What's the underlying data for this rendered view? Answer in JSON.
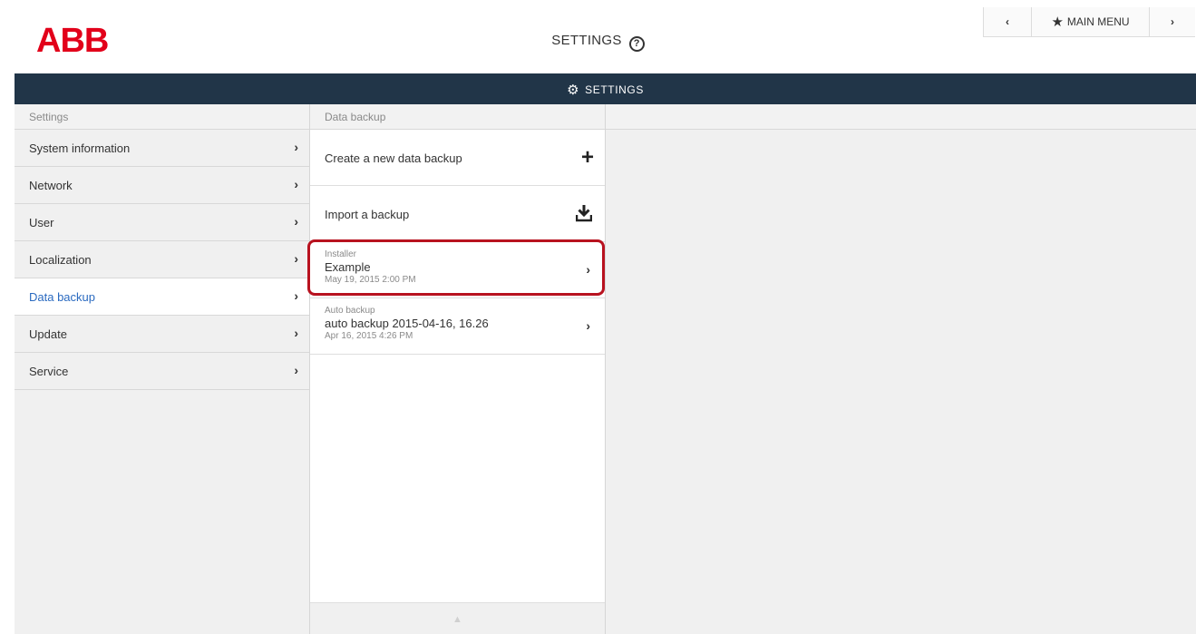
{
  "brand": {
    "logo_text": "ABB",
    "color": "#e2001a"
  },
  "header": {
    "title": "SETTINGS",
    "help_glyph": "?"
  },
  "topnav": {
    "back_glyph": "‹",
    "main_menu_label": "MAIN MENU",
    "forward_glyph": "›",
    "star_glyph": "★"
  },
  "darkbar": {
    "label": "SETTINGS",
    "icon": "gear-icon",
    "color": "#213548"
  },
  "left_column": {
    "header": "Settings",
    "items": [
      {
        "label": "System information",
        "active": false
      },
      {
        "label": "Network",
        "active": false
      },
      {
        "label": "User",
        "active": false
      },
      {
        "label": "Localization",
        "active": false
      },
      {
        "label": "Data backup",
        "active": true
      },
      {
        "label": "Update",
        "active": false
      },
      {
        "label": "Service",
        "active": false
      }
    ]
  },
  "mid_column": {
    "header": "Data backup",
    "actions": [
      {
        "label": "Create a new data backup",
        "icon": "plus-icon",
        "glyph": "+"
      },
      {
        "label": "Import a backup",
        "icon": "import-icon"
      }
    ],
    "backups": [
      {
        "category": "Installer",
        "name": "Example",
        "date": "May 19, 2015 2:00 PM",
        "highlighted": true
      },
      {
        "category": "Auto backup",
        "name": "auto backup 2015-04-16, 16.26",
        "date": "Apr 16, 2015 4:26 PM",
        "highlighted": false
      }
    ]
  },
  "chevron_glyph": "›",
  "colors": {
    "highlight": "#b8121f",
    "active_text": "#2a6ac0"
  }
}
